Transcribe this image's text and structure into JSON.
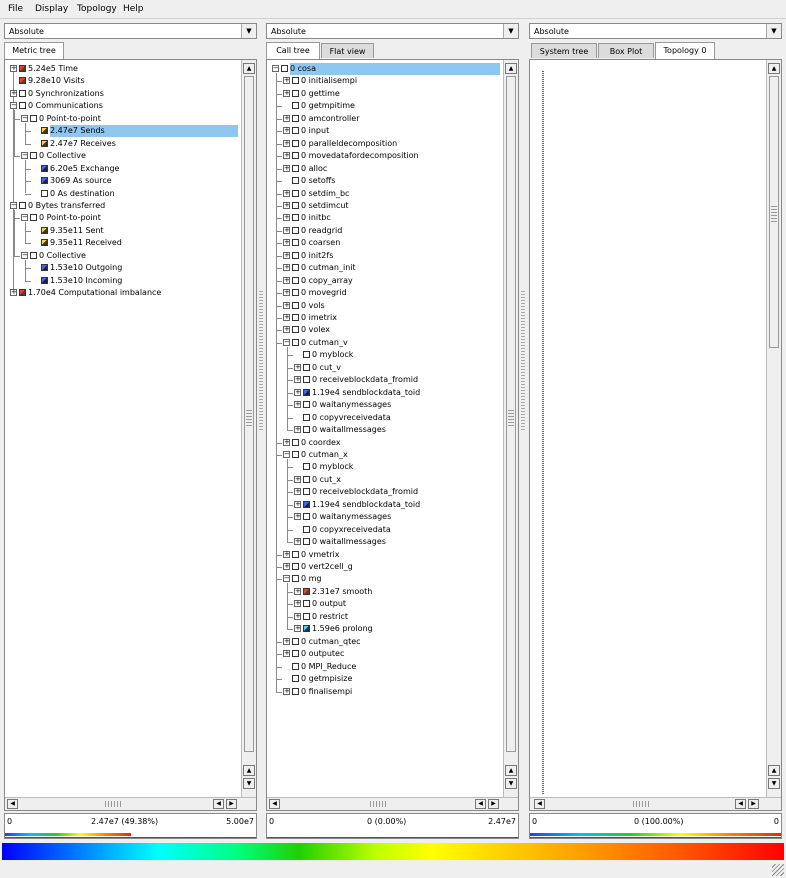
{
  "menu": [
    "File",
    "Display",
    "Topology",
    "Help"
  ],
  "combos": [
    "Absolute",
    "Absolute",
    "Absolute"
  ],
  "left": {
    "tabs": [
      "Metric tree"
    ],
    "rows": [
      {
        "d": 0,
        "e": "+",
        "c": "red",
        "t": "5.24e5 Time"
      },
      {
        "d": 0,
        "e": "",
        "c": "red",
        "t": "9.28e10 Visits"
      },
      {
        "d": 0,
        "e": "+",
        "c": "",
        "t": "0 Synchronizations"
      },
      {
        "d": 0,
        "e": "-",
        "c": "",
        "t": "0 Communications"
      },
      {
        "d": 1,
        "e": "-",
        "c": "",
        "t": "0 Point-to-point"
      },
      {
        "d": 2,
        "e": "",
        "c": "yel",
        "t": "2.47e7 Sends",
        "sel": true
      },
      {
        "d": 2,
        "e": "",
        "c": "yel",
        "t": "2.47e7 Receives"
      },
      {
        "d": 1,
        "e": "-",
        "c": "",
        "t": "0 Collective"
      },
      {
        "d": 2,
        "e": "",
        "c": "blu",
        "t": "6.20e5 Exchange"
      },
      {
        "d": 2,
        "e": "",
        "c": "blu",
        "t": "3069 As source"
      },
      {
        "d": 2,
        "e": "",
        "c": "",
        "t": "0 As destination"
      },
      {
        "d": 0,
        "e": "-",
        "c": "",
        "t": "0 Bytes transferred"
      },
      {
        "d": 1,
        "e": "-",
        "c": "",
        "t": "0 Point-to-point"
      },
      {
        "d": 2,
        "e": "",
        "c": "yel",
        "t": "9.35e11 Sent"
      },
      {
        "d": 2,
        "e": "",
        "c": "yel",
        "t": "9.35e11 Received"
      },
      {
        "d": 1,
        "e": "-",
        "c": "",
        "t": "0 Collective"
      },
      {
        "d": 2,
        "e": "",
        "c": "blu",
        "t": "1.53e10 Outgoing"
      },
      {
        "d": 2,
        "e": "",
        "c": "blu",
        "t": "1.53e10 Incoming"
      },
      {
        "d": 0,
        "e": "+",
        "c": "red",
        "t": "1.70e4 Computational imbalance"
      }
    ],
    "value_min": "0",
    "value_mid": "2.47e7 (49.38%)",
    "value_max": "5.00e7"
  },
  "middle": {
    "tabs": [
      "Call tree",
      "Flat view"
    ],
    "rows": [
      {
        "d": 0,
        "e": "-",
        "c": "",
        "t": "0 cosa",
        "sel": true
      },
      {
        "d": 1,
        "e": "+",
        "c": "",
        "t": "0 initialisempi"
      },
      {
        "d": 1,
        "e": "+",
        "c": "",
        "t": "0 gettime"
      },
      {
        "d": 1,
        "e": "",
        "c": "",
        "t": "0 getmpitime"
      },
      {
        "d": 1,
        "e": "+",
        "c": "",
        "t": "0 amcontroller"
      },
      {
        "d": 1,
        "e": "+",
        "c": "",
        "t": "0 input"
      },
      {
        "d": 1,
        "e": "+",
        "c": "",
        "t": "0 paralleldecomposition"
      },
      {
        "d": 1,
        "e": "+",
        "c": "",
        "t": "0 movedatafordecomposition"
      },
      {
        "d": 1,
        "e": "+",
        "c": "",
        "t": "0 alloc"
      },
      {
        "d": 1,
        "e": "",
        "c": "",
        "t": "0 setoffs"
      },
      {
        "d": 1,
        "e": "+",
        "c": "",
        "t": "0 setdim_bc"
      },
      {
        "d": 1,
        "e": "+",
        "c": "",
        "t": "0 setdimcut"
      },
      {
        "d": 1,
        "e": "+",
        "c": "",
        "t": "0 initbc"
      },
      {
        "d": 1,
        "e": "+",
        "c": "",
        "t": "0 readgrid"
      },
      {
        "d": 1,
        "e": "+",
        "c": "",
        "t": "0 coarsen"
      },
      {
        "d": 1,
        "e": "+",
        "c": "",
        "t": "0 init2fs"
      },
      {
        "d": 1,
        "e": "+",
        "c": "",
        "t": "0 cutman_init"
      },
      {
        "d": 1,
        "e": "+",
        "c": "",
        "t": "0 copy_array"
      },
      {
        "d": 1,
        "e": "+",
        "c": "",
        "t": "0 movegrid"
      },
      {
        "d": 1,
        "e": "+",
        "c": "",
        "t": "0 vols"
      },
      {
        "d": 1,
        "e": "+",
        "c": "",
        "t": "0 imetrix"
      },
      {
        "d": 1,
        "e": "+",
        "c": "",
        "t": "0 volex"
      },
      {
        "d": 1,
        "e": "-",
        "c": "",
        "t": "0 cutman_v"
      },
      {
        "d": 2,
        "e": "",
        "c": "",
        "t": "0 myblock"
      },
      {
        "d": 2,
        "e": "+",
        "c": "",
        "t": "0 cut_v"
      },
      {
        "d": 2,
        "e": "+",
        "c": "",
        "t": "0 receiveblockdata_fromid"
      },
      {
        "d": 2,
        "e": "+",
        "c": "blu",
        "t": "1.19e4 sendblockdata_toid"
      },
      {
        "d": 2,
        "e": "+",
        "c": "",
        "t": "0 waitanymessages"
      },
      {
        "d": 2,
        "e": "",
        "c": "",
        "t": "0 copyvreceivedata"
      },
      {
        "d": 2,
        "e": "+",
        "c": "",
        "t": "0 waitallmessages"
      },
      {
        "d": 1,
        "e": "+",
        "c": "",
        "t": "0 coordex"
      },
      {
        "d": 1,
        "e": "-",
        "c": "",
        "t": "0 cutman_x"
      },
      {
        "d": 2,
        "e": "",
        "c": "",
        "t": "0 myblock"
      },
      {
        "d": 2,
        "e": "+",
        "c": "",
        "t": "0 cut_x"
      },
      {
        "d": 2,
        "e": "+",
        "c": "",
        "t": "0 receiveblockdata_fromid"
      },
      {
        "d": 2,
        "e": "+",
        "c": "blu",
        "t": "1.19e4 sendblockdata_toid"
      },
      {
        "d": 2,
        "e": "+",
        "c": "",
        "t": "0 waitanymessages"
      },
      {
        "d": 2,
        "e": "",
        "c": "",
        "t": "0 copyxreceivedata"
      },
      {
        "d": 2,
        "e": "+",
        "c": "",
        "t": "0 waitallmessages"
      },
      {
        "d": 1,
        "e": "+",
        "c": "",
        "t": "0 vmetrix"
      },
      {
        "d": 1,
        "e": "+",
        "c": "",
        "t": "0 vert2cell_g"
      },
      {
        "d": 1,
        "e": "-",
        "c": "",
        "t": "0 mg"
      },
      {
        "d": 2,
        "e": "+",
        "c": "red",
        "t": "2.31e7 smooth"
      },
      {
        "d": 2,
        "e": "+",
        "c": "",
        "t": "0 output"
      },
      {
        "d": 2,
        "e": "+",
        "c": "",
        "t": "0 restrict"
      },
      {
        "d": 2,
        "e": "+",
        "c": "cyan",
        "t": "1.59e6 prolong"
      },
      {
        "d": 1,
        "e": "+",
        "c": "",
        "t": "0 cutman_qtec"
      },
      {
        "d": 1,
        "e": "+",
        "c": "",
        "t": "0 outputec"
      },
      {
        "d": 1,
        "e": "",
        "c": "",
        "t": "0 MPI_Reduce"
      },
      {
        "d": 1,
        "e": "",
        "c": "",
        "t": "0 getmpisize"
      },
      {
        "d": 1,
        "e": "+",
        "c": "",
        "t": "0 finalisempi"
      }
    ],
    "value_min": "0",
    "value_mid": "0 (0.00%)",
    "value_max": "2.47e7"
  },
  "right": {
    "tabs": [
      "System tree",
      "Box Plot",
      "Topology 0"
    ],
    "value_min": "0",
    "value_mid": "0 (100.00%)",
    "value_max": "0"
  },
  "colors": {
    "selection": "#8fc6ef",
    "red": "#ff3a1e",
    "yellow": "#ffcf3a",
    "blue": "#3b64ff"
  }
}
